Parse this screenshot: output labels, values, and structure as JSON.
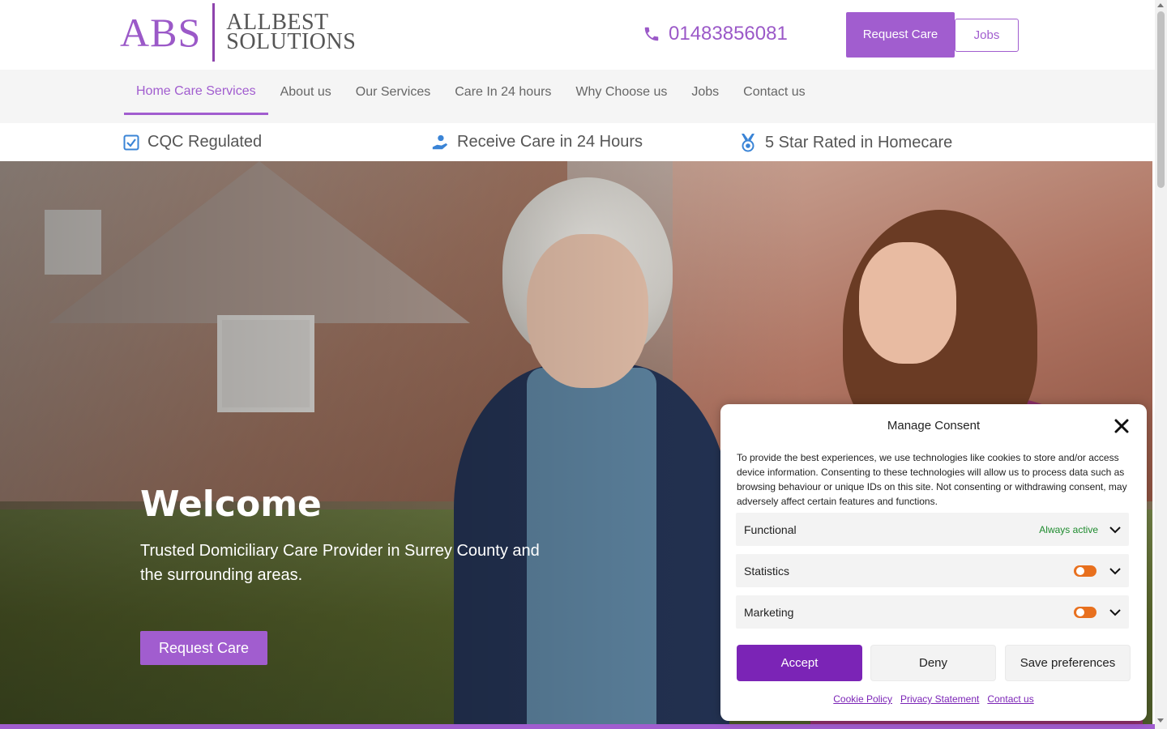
{
  "header": {
    "logo_abs": "ABS",
    "logo_line1": "ALLBEST",
    "logo_line2": "SOLUTIONS",
    "phone": "01483856081",
    "request_care": "Request Care",
    "jobs": "Jobs"
  },
  "nav": {
    "items": [
      {
        "label": "Home Care Services",
        "active": true
      },
      {
        "label": "About us"
      },
      {
        "label": "Our Services"
      },
      {
        "label": "Care In 24 hours"
      },
      {
        "label": "Why Choose us"
      },
      {
        "label": "Jobs"
      },
      {
        "label": "Contact us"
      }
    ]
  },
  "features": [
    {
      "label": "CQC Regulated",
      "icon": "checkbox-icon"
    },
    {
      "label": "Receive Care in 24 Hours",
      "icon": "care-hand-icon"
    },
    {
      "label": "5 Star Rated in Homecare",
      "icon": "medal-icon"
    }
  ],
  "hero": {
    "title": "Welcome",
    "subtitle": "Trusted Domiciliary Care Provider in Surrey County and the surrounding areas.",
    "button": "Request Care"
  },
  "consent": {
    "title": "Manage Consent",
    "text": "To provide the best experiences, we use technologies like cookies to store and/or access device information. Consenting to these technologies will allow us to process data such as browsing behaviour or unique IDs on this site. Not consenting or withdrawing consent, may adversely affect certain features and functions.",
    "categories": [
      {
        "label": "Functional",
        "status": "Always active"
      },
      {
        "label": "Statistics"
      },
      {
        "label": "Marketing"
      }
    ],
    "accept": "Accept",
    "deny": "Deny",
    "save": "Save preferences",
    "links": [
      "Cookie Policy",
      "Privacy Statement",
      "Contact us"
    ]
  },
  "colors": {
    "brand_purple": "#a15dcf",
    "accept_purple": "#7b24b6",
    "toggle_orange": "#e8701e",
    "always_active_green": "#1e8b2e"
  }
}
